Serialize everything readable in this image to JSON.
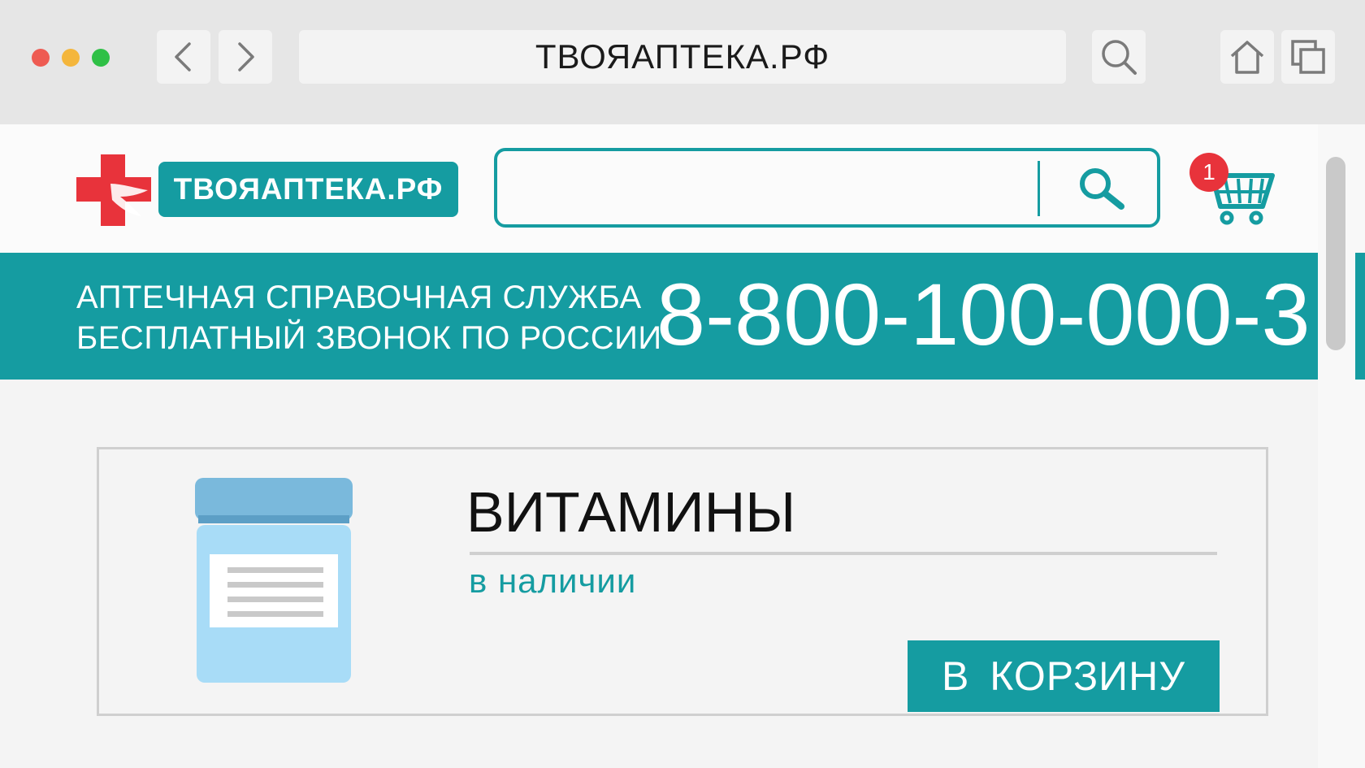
{
  "browser": {
    "url": "ТВОЯАПТЕКА.РФ",
    "icons": {
      "back": "chevron-left-icon",
      "forward": "chevron-right-icon",
      "search": "magnifier-icon",
      "home": "home-icon",
      "tabs": "tabs-icon"
    },
    "window_controls": [
      "#ee5b52",
      "#f4b63c",
      "#2fc046"
    ]
  },
  "header": {
    "logo_text": "ТВОЯАПТЕКА.РФ",
    "search": {
      "value": "",
      "placeholder": ""
    },
    "cart_count": "1"
  },
  "banner": {
    "line1": "АПТЕЧНАЯ СПРАВОЧНАЯ СЛУЖБА",
    "line2": "БЕСПЛАТНЫЙ ЗВОНОК ПО РОССИИ",
    "phone": "8-800-100-000-3"
  },
  "product": {
    "title": "ВИТАМИНЫ",
    "status": "в наличии",
    "button_label": "В КОРЗИНУ"
  },
  "colors": {
    "accent": "#159ca1",
    "badge": "#e8333b",
    "logo_cross": "#e8333b"
  }
}
